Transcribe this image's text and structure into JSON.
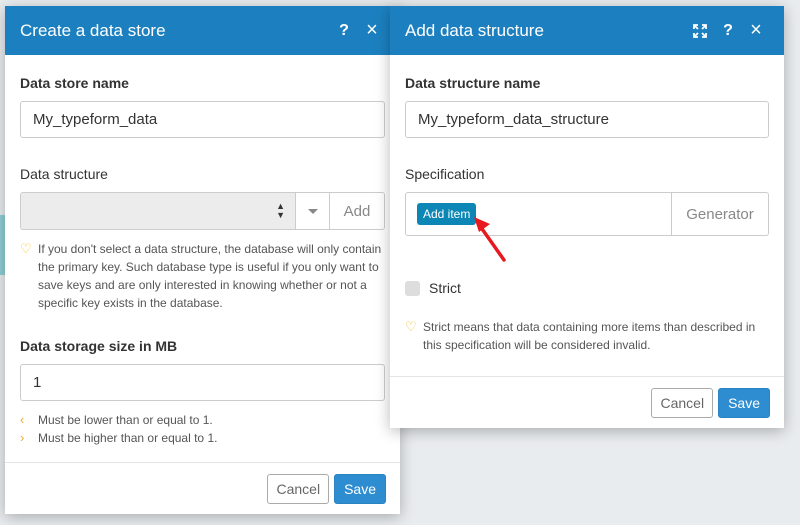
{
  "left_dialog": {
    "title": "Create a data store",
    "help_icon": "?",
    "close_icon": "×",
    "store_name_label": "Data store name",
    "store_name_value": "My_typeform_data",
    "structure_label": "Data structure",
    "structure_add": "Add",
    "structure_hint": "If you don't select a data structure, the database will only contain the primary key. Such database type is useful if you only want to save keys and are only interested in knowing whether or not a specific key exists in the database.",
    "size_label": "Data storage size in MB",
    "size_value": "1",
    "rule_lower": "Must be lower than or equal to 1.",
    "rule_higher": "Must be higher than or equal to 1.",
    "cancel_label": "Cancel",
    "save_label": "Save"
  },
  "right_dialog": {
    "title": "Add data structure",
    "help_icon": "?",
    "close_icon": "×",
    "name_label": "Data structure name",
    "name_value": "My_typeform_data_structure",
    "spec_label": "Specification",
    "add_item_label": "Add item",
    "generator_label": "Generator",
    "strict_label": "Strict",
    "strict_hint": "Strict means that data containing more items than described in this specification will be considered invalid.",
    "cancel_label": "Cancel",
    "save_label": "Save"
  },
  "colors": {
    "header_blue": "#1c80c0",
    "button_blue": "#2e8dd1",
    "arrow_red": "#e8191e",
    "hint_yellow": "#f2c037"
  }
}
